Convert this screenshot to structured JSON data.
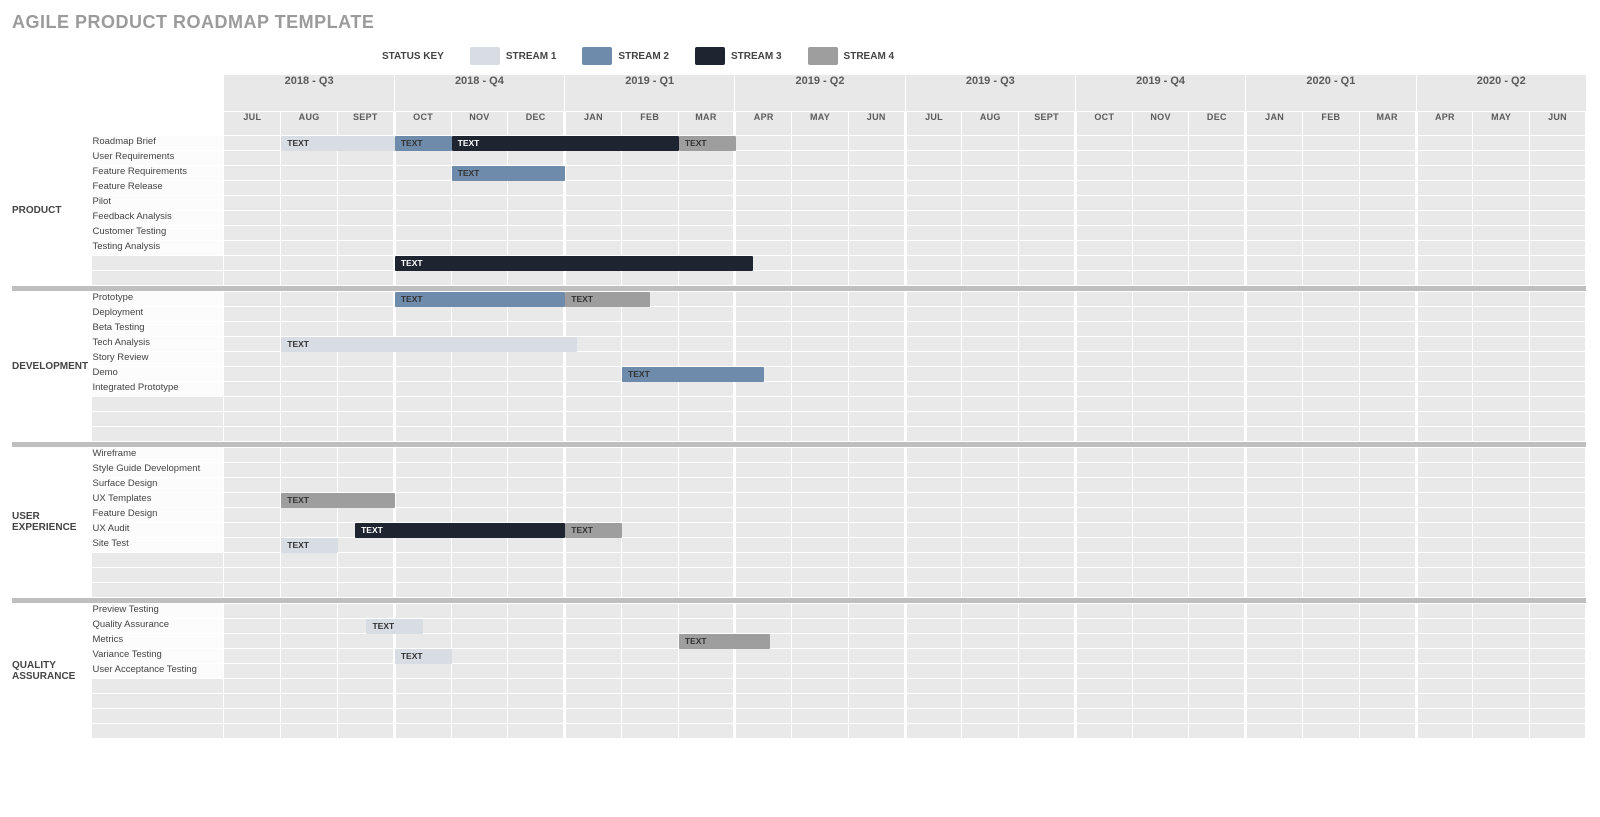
{
  "title": "AGILE PRODUCT ROADMAP TEMPLATE",
  "legend": {
    "key_label": "STATUS KEY",
    "streams": [
      {
        "label": "STREAM 1",
        "color": "#d7dde3"
      },
      {
        "label": "STREAM 2",
        "color": "#6f8bab"
      },
      {
        "label": "STREAM 3",
        "color": "#1e2430"
      },
      {
        "label": "STREAM 4",
        "color": "#9e9e9e"
      }
    ]
  },
  "quarters": [
    "2018 - Q3",
    "2018 - Q4",
    "2019 - Q1",
    "2019 - Q2",
    "2019 - Q3",
    "2019 - Q4",
    "2020 - Q1",
    "2020 - Q2"
  ],
  "months": [
    "JUL",
    "AUG",
    "SEPT",
    "OCT",
    "NOV",
    "DEC",
    "JAN",
    "FEB",
    "MAR",
    "APR",
    "MAY",
    "JUN",
    "JUL",
    "AUG",
    "SEPT",
    "OCT",
    "NOV",
    "DEC",
    "JAN",
    "FEB",
    "MAR",
    "APR",
    "MAY",
    "JUN"
  ],
  "bar_text": "TEXT",
  "sections": [
    {
      "name": "PRODUCT",
      "rows": [
        {
          "label": "Roadmap Brief",
          "bars": [
            {
              "stream": 0,
              "start": 1,
              "span": 2
            },
            {
              "stream": 1,
              "start": 3,
              "span": 1
            },
            {
              "stream": 2,
              "start": 4,
              "span": 4
            },
            {
              "stream": 3,
              "start": 8,
              "span": 1
            }
          ]
        },
        {
          "label": "User Requirements",
          "bars": []
        },
        {
          "label": "Feature Requirements",
          "bars": [
            {
              "stream": 1,
              "start": 4,
              "span": 2
            }
          ]
        },
        {
          "label": "Feature Release",
          "bars": []
        },
        {
          "label": "Pilot",
          "bars": []
        },
        {
          "label": "Feedback Analysis",
          "bars": []
        },
        {
          "label": "Customer Testing",
          "bars": []
        },
        {
          "label": "Testing Analysis",
          "bars": []
        },
        {
          "label": "",
          "bars": [
            {
              "stream": 2,
              "start": 3,
              "span": 6.3
            }
          ]
        },
        {
          "label": "",
          "bars": []
        }
      ]
    },
    {
      "name": "DEVELOPMENT",
      "rows": [
        {
          "label": "Prototype",
          "bars": [
            {
              "stream": 1,
              "start": 3,
              "span": 3
            },
            {
              "stream": 3,
              "start": 6,
              "span": 1.5
            }
          ]
        },
        {
          "label": "Deployment",
          "bars": []
        },
        {
          "label": "Beta Testing",
          "bars": []
        },
        {
          "label": "Tech Analysis",
          "bars": [
            {
              "stream": 0,
              "start": 1,
              "span": 5.2
            }
          ]
        },
        {
          "label": "Story Review",
          "bars": []
        },
        {
          "label": "Demo",
          "bars": [
            {
              "stream": 1,
              "start": 7,
              "span": 2.5
            }
          ]
        },
        {
          "label": "Integrated Prototype",
          "bars": []
        },
        {
          "label": "",
          "bars": []
        },
        {
          "label": "",
          "bars": []
        },
        {
          "label": "",
          "bars": []
        }
      ]
    },
    {
      "name": "USER EXPERIENCE",
      "rows": [
        {
          "label": "Wireframe",
          "bars": []
        },
        {
          "label": "Style Guide Development",
          "bars": []
        },
        {
          "label": "Surface Design",
          "bars": []
        },
        {
          "label": "UX Templates",
          "bars": [
            {
              "stream": 3,
              "start": 1,
              "span": 2
            }
          ]
        },
        {
          "label": "Feature Design",
          "bars": []
        },
        {
          "label": "UX Audit",
          "bars": [
            {
              "stream": 2,
              "start": 2.3,
              "span": 3.7
            },
            {
              "stream": 3,
              "start": 6,
              "span": 1
            }
          ]
        },
        {
          "label": "Site Test",
          "bars": [
            {
              "stream": 0,
              "start": 1,
              "span": 1
            }
          ]
        },
        {
          "label": "",
          "bars": []
        },
        {
          "label": "",
          "bars": []
        },
        {
          "label": "",
          "bars": []
        }
      ]
    },
    {
      "name": "QUALITY ASSURANCE",
      "rows": [
        {
          "label": "Preview Testing",
          "bars": []
        },
        {
          "label": "Quality Assurance",
          "bars": [
            {
              "stream": 0,
              "start": 2.5,
              "span": 1
            }
          ]
        },
        {
          "label": "Metrics",
          "bars": [
            {
              "stream": 3,
              "start": 8,
              "span": 1.6
            }
          ]
        },
        {
          "label": "Variance Testing",
          "bars": [
            {
              "stream": 0,
              "start": 3,
              "span": 1
            }
          ]
        },
        {
          "label": "User Acceptance Testing",
          "bars": []
        },
        {
          "label": "",
          "bars": []
        },
        {
          "label": "",
          "bars": []
        },
        {
          "label": "",
          "bars": []
        },
        {
          "label": "",
          "bars": []
        }
      ]
    }
  ]
}
